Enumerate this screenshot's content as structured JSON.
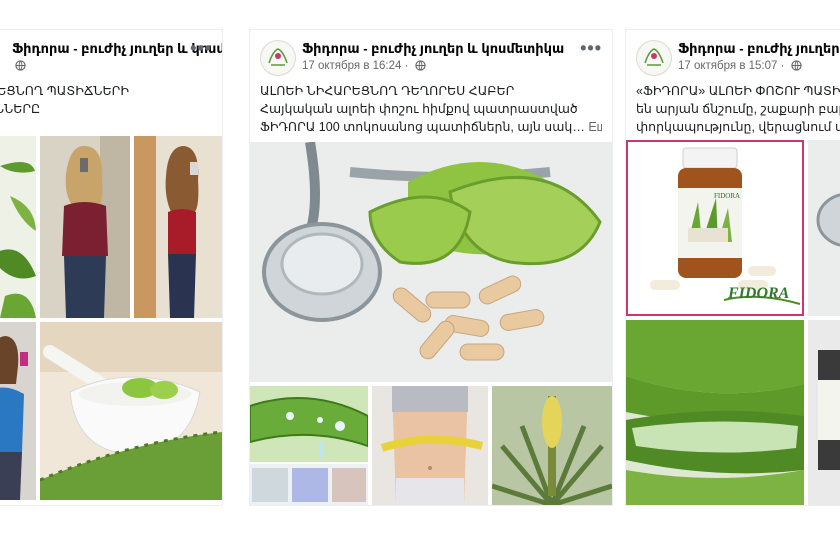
{
  "posts": [
    {
      "page_name": "Ֆիդորա - բուժիչ յուղեր և կոսմետիկա",
      "meta": "",
      "text_lines": [
        "ՀԱՐԵՑՆՈՂ ՊԱՏԻՃՆԵՐԻ",
        "ՅՈՒՆՆԵՐԸ"
      ],
      "photos": [
        "woman-selfie-blue-photo",
        "aloe-leaves-photo",
        "woman-before-photo",
        "woman-after-photo",
        "woman-mirror-selfie-photo",
        "mortar-aloe-photo"
      ]
    },
    {
      "page_name": "Ֆիդորա - բուժիչ յուղեր և կոսմետիկա",
      "meta": "17 октября в 16:24 ·",
      "text_lines": [
        "ԱԼՈԵԻ ՆԻՀԱՐԵՑՆՈՂ ԴԵՂՈՐԵՍ ՀԱԲԵՐ",
        "Հայկական ալոեի փոշու հիմքով պատրաստված",
        "ՖԻԴՈՐԱ 100 տոկոսանոց պատիճներն, այն սակ…"
      ],
      "see_more": "Ещё",
      "photos": [
        "stethoscope-capsules-aloe-photo",
        "aloe-gel-drops-photo",
        "measuring-tape-waist-photo",
        "aloe-flower-photo"
      ]
    },
    {
      "page_name": "Ֆիդորա - բուժիչ յուղեր և կոսմետիկա",
      "meta": "17 октября в 15:07 ·",
      "text_lines": [
        "«ՖԻԴՈՐԱ» ԱԼՈԵԻ ՓՈՇՈՒ ՊԱՏԻՃ",
        "են արյան ճնշումը, շաքարի բարձր",
        "փորկապությունը, վերացնում վա"
      ],
      "product_brand": "FIDORA",
      "photos": [
        "fidora-capsule-jar-photo",
        "aloe-leaf-slices-photo"
      ]
    }
  ],
  "colors": {
    "accent_border": "#c8376d",
    "aloe_green": "#7cb342",
    "text_primary": "#1c1e21",
    "text_secondary": "#65676b"
  }
}
